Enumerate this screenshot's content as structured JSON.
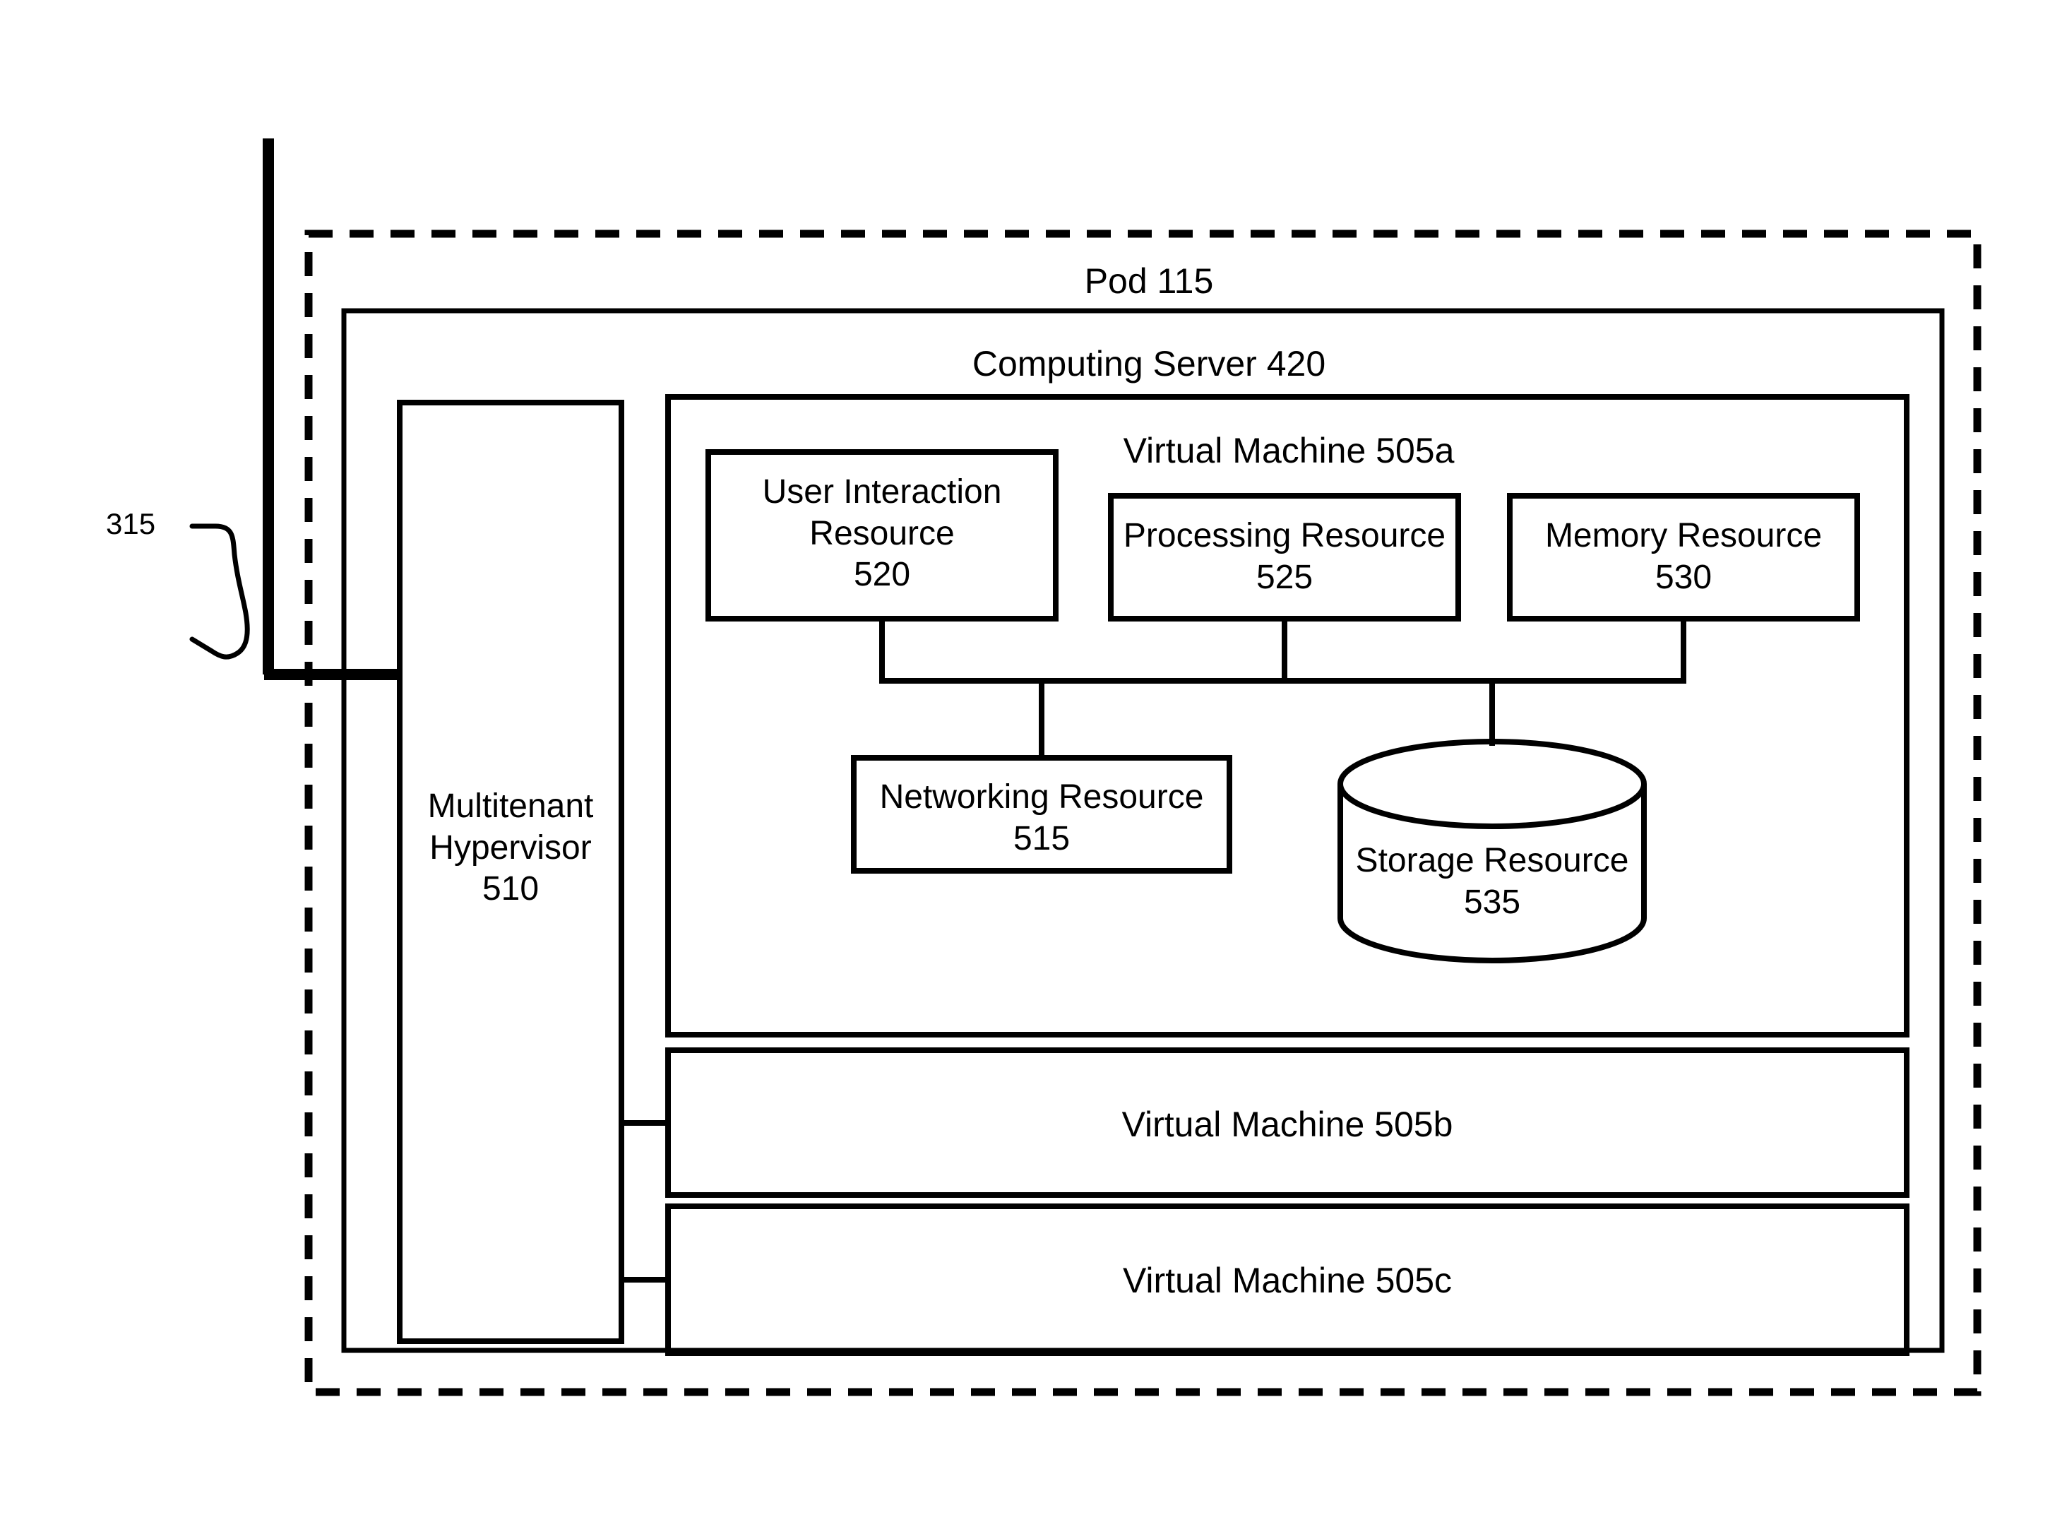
{
  "figure": {
    "reference_numeral": "315",
    "outer_container": {
      "label": "Pod 115",
      "border_style": "dashed"
    },
    "server": {
      "label": "Computing Server 420"
    },
    "hypervisor": {
      "line1": "Multitenant",
      "line2": "Hypervisor",
      "line3": "510"
    },
    "virtual_machines": [
      {
        "label": "Virtual Machine 505a",
        "id": "505a"
      },
      {
        "label": "Virtual Machine 505b",
        "id": "505b"
      },
      {
        "label": "Virtual Machine 505c",
        "id": "505c"
      }
    ],
    "resources": [
      {
        "name": "user-interaction-resource",
        "line1": "User Interaction",
        "line2": "Resource",
        "line3": "520",
        "shape": "rectangle"
      },
      {
        "name": "processing-resource",
        "line1": "Processing Resource",
        "line2": "525",
        "shape": "rectangle"
      },
      {
        "name": "memory-resource",
        "line1": "Memory Resource",
        "line2": "530",
        "shape": "rectangle"
      },
      {
        "name": "networking-resource",
        "line1": "Networking Resource",
        "line2": "515",
        "shape": "rectangle"
      },
      {
        "name": "storage-resource",
        "line1": "Storage Resource",
        "line2": "535",
        "shape": "cylinder"
      }
    ],
    "colors": {
      "stroke": "#000000",
      "background": "#ffffff"
    }
  }
}
